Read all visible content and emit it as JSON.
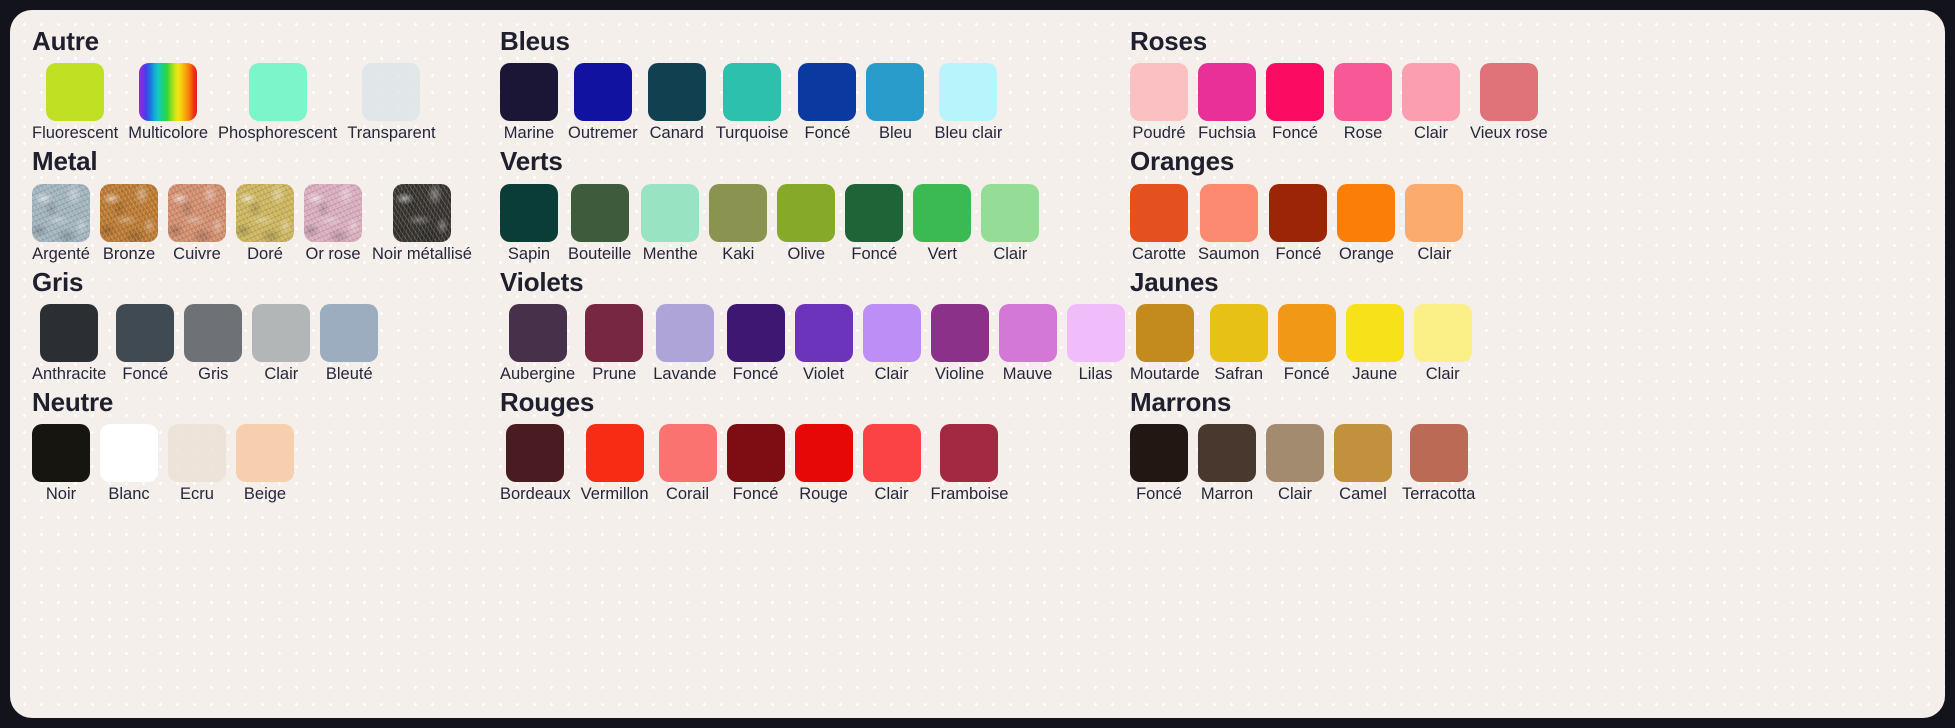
{
  "board": {
    "background": "#f4efea",
    "page_background": "#13131c",
    "title_color": "#1f1f2e",
    "label_color": "#26263a"
  },
  "columns": [
    {
      "name": "left",
      "groups": [
        {
          "title": "Autre",
          "swatches": [
            {
              "label": "Fluorescent",
              "color": "#bfe023",
              "style": "solid"
            },
            {
              "label": "Multicolore",
              "color": "rainbow",
              "style": "rainbow"
            },
            {
              "label": "Phosphorescent",
              "color": "#7cf5cb",
              "style": "solid"
            },
            {
              "label": "Transparent",
              "color": "#dde5e8",
              "style": "translucent"
            }
          ]
        },
        {
          "title": "Metal",
          "swatches": [
            {
              "label": "Argenté",
              "color": "#9fb1bb",
              "style": "metal"
            },
            {
              "label": "Bronze",
              "color": "#b9762e",
              "style": "metal"
            },
            {
              "label": "Cuivre",
              "color": "#d08a6a",
              "style": "metal"
            },
            {
              "label": "Doré",
              "color": "#c9b259",
              "style": "metal"
            },
            {
              "label": "Or rose",
              "color": "#d7aabb",
              "style": "metal"
            },
            {
              "label": "Noir métallisé",
              "color": "#33302b",
              "style": "metal"
            }
          ]
        },
        {
          "title": "Gris",
          "swatches": [
            {
              "label": "Anthracite",
              "color": "#2b2f33",
              "style": "solid"
            },
            {
              "label": "Foncé",
              "color": "#3f4a52",
              "style": "solid"
            },
            {
              "label": "Gris",
              "color": "#6e7276",
              "style": "solid"
            },
            {
              "label": "Clair",
              "color": "#b3b6b6",
              "style": "solid"
            },
            {
              "label": "Bleuté",
              "color": "#9badbe",
              "style": "solid"
            }
          ]
        },
        {
          "title": "Neutre",
          "swatches": [
            {
              "label": "Noir",
              "color": "#17150f",
              "style": "solid"
            },
            {
              "label": "Blanc",
              "color": "#ffffff",
              "style": "solid"
            },
            {
              "label": "Ecru",
              "color": "#ece1d5",
              "style": "translucent"
            },
            {
              "label": "Beige",
              "color": "#f5cfae",
              "style": "solid"
            }
          ]
        }
      ]
    },
    {
      "name": "middle",
      "groups": [
        {
          "title": "Bleus",
          "swatches": [
            {
              "label": "Marine",
              "color": "#1b1636",
              "style": "solid"
            },
            {
              "label": "Outremer",
              "color": "#1212a0",
              "style": "solid"
            },
            {
              "label": "Canard",
              "color": "#114050",
              "style": "solid"
            },
            {
              "label": "Turquoise",
              "color": "#2cc0ad",
              "style": "solid"
            },
            {
              "label": "Foncé",
              "color": "#0a39a0",
              "style": "solid"
            },
            {
              "label": "Bleu",
              "color": "#2a9ccb",
              "style": "solid"
            },
            {
              "label": "Bleu clair",
              "color": "#b5f5fb",
              "style": "solid"
            }
          ]
        },
        {
          "title": "Verts",
          "swatches": [
            {
              "label": "Sapin",
              "color": "#0a3c38",
              "style": "solid"
            },
            {
              "label": "Bouteille",
              "color": "#3e5c3c",
              "style": "solid"
            },
            {
              "label": "Menthe",
              "color": "#97e3c2",
              "style": "solid"
            },
            {
              "label": "Kaki",
              "color": "#8b9350",
              "style": "solid"
            },
            {
              "label": "Olive",
              "color": "#87a92a",
              "style": "solid"
            },
            {
              "label": "Foncé",
              "color": "#1f6436",
              "style": "solid"
            },
            {
              "label": "Vert",
              "color": "#3bba53",
              "style": "solid"
            },
            {
              "label": "Clair",
              "color": "#95dd96",
              "style": "solid"
            }
          ]
        },
        {
          "title": "Violets",
          "swatches": [
            {
              "label": "Aubergine",
              "color": "#47304a",
              "style": "solid"
            },
            {
              "label": "Prune",
              "color": "#782743",
              "style": "solid"
            },
            {
              "label": "Lavande",
              "color": "#aea4d8",
              "style": "solid"
            },
            {
              "label": "Foncé",
              "color": "#3d1772",
              "style": "solid"
            },
            {
              "label": "Violet",
              "color": "#6c34bb",
              "style": "solid"
            },
            {
              "label": "Clair",
              "color": "#bd8ef6",
              "style": "solid"
            },
            {
              "label": "Violine",
              "color": "#8b3189",
              "style": "solid"
            },
            {
              "label": "Mauve",
              "color": "#d478d8",
              "style": "solid"
            },
            {
              "label": "Lilas",
              "color": "#f0bdfa",
              "style": "solid"
            }
          ]
        },
        {
          "title": "Rouges",
          "swatches": [
            {
              "label": "Bordeaux",
              "color": "#481c20",
              "style": "solid"
            },
            {
              "label": "Vermillon",
              "color": "#f62d14",
              "style": "solid"
            },
            {
              "label": "Corail",
              "color": "#fb7370",
              "style": "solid"
            },
            {
              "label": "Foncé",
              "color": "#7d0d13",
              "style": "solid"
            },
            {
              "label": "Rouge",
              "color": "#e60707",
              "style": "solid"
            },
            {
              "label": "Clair",
              "color": "#fb4244",
              "style": "solid"
            },
            {
              "label": "Framboise",
              "color": "#a32943",
              "style": "solid"
            }
          ]
        }
      ]
    },
    {
      "name": "right",
      "groups": [
        {
          "title": "Roses",
          "swatches": [
            {
              "label": "Poudré",
              "color": "#fbc0c2",
              "style": "solid"
            },
            {
              "label": "Fuchsia",
              "color": "#e83098",
              "style": "solid"
            },
            {
              "label": "Foncé",
              "color": "#fc0b63",
              "style": "solid"
            },
            {
              "label": "Rose",
              "color": "#f95897",
              "style": "solid"
            },
            {
              "label": "Clair",
              "color": "#fb9eb0",
              "style": "solid"
            },
            {
              "label": "Vieux rose",
              "color": "#e0727a",
              "style": "solid"
            }
          ]
        },
        {
          "title": "Oranges",
          "swatches": [
            {
              "label": "Carotte",
              "color": "#e4511f",
              "style": "solid"
            },
            {
              "label": "Saumon",
              "color": "#fb8a71",
              "style": "solid"
            },
            {
              "label": "Foncé",
              "color": "#9b2506",
              "style": "solid"
            },
            {
              "label": "Orange",
              "color": "#fb7e09",
              "style": "solid"
            },
            {
              "label": "Clair",
              "color": "#fcab6f",
              "style": "solid"
            }
          ]
        },
        {
          "title": "Jaunes",
          "swatches": [
            {
              "label": "Moutarde",
              "color": "#c38b1d",
              "style": "solid"
            },
            {
              "label": "Safran",
              "color": "#e7c115",
              "style": "solid"
            },
            {
              "label": "Foncé",
              "color": "#f19916",
              "style": "solid"
            },
            {
              "label": "Jaune",
              "color": "#f7e119",
              "style": "solid"
            },
            {
              "label": "Clair",
              "color": "#fbf087",
              "style": "solid"
            }
          ]
        },
        {
          "title": "Marrons",
          "swatches": [
            {
              "label": "Foncé",
              "color": "#221712",
              "style": "solid"
            },
            {
              "label": "Marron",
              "color": "#48382e",
              "style": "solid"
            },
            {
              "label": "Clair",
              "color": "#a38b70",
              "style": "solid"
            },
            {
              "label": "Camel",
              "color": "#c2913e",
              "style": "solid"
            },
            {
              "label": "Terracotta",
              "color": "#ba6a55",
              "style": "solid"
            }
          ]
        }
      ]
    }
  ]
}
